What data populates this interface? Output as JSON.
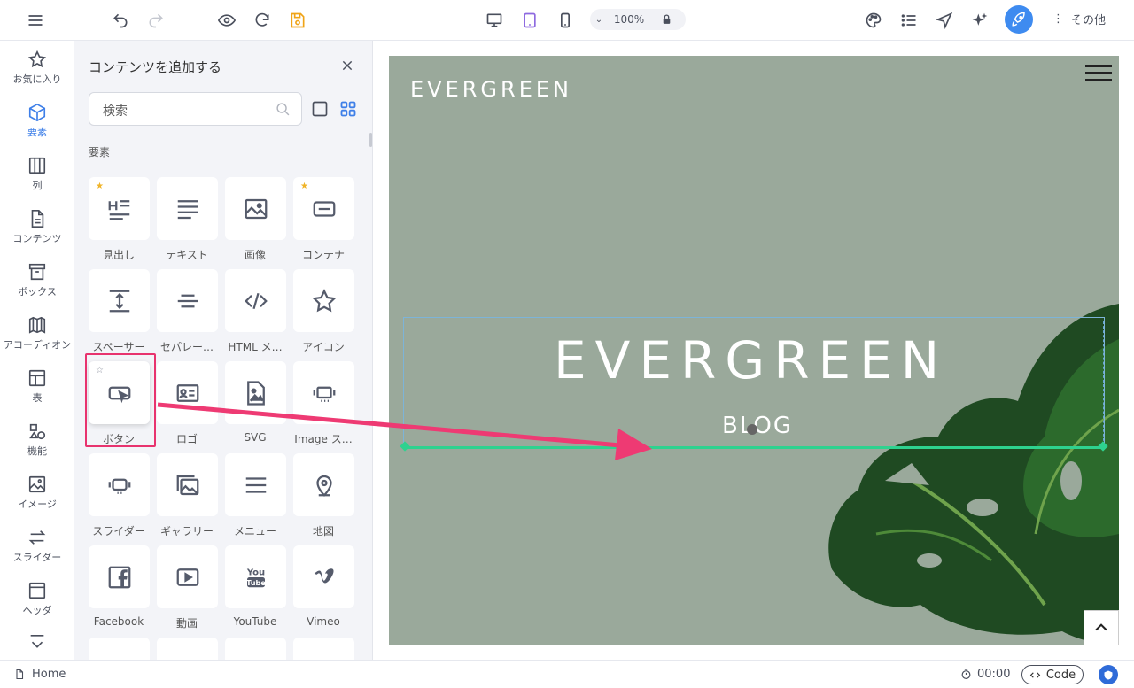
{
  "toolbar": {
    "zoom_value": "100%",
    "more_label": "その他"
  },
  "sidebar": {
    "items": [
      {
        "label": "お気に入り"
      },
      {
        "label": "要素"
      },
      {
        "label": "列"
      },
      {
        "label": "コンテンツ"
      },
      {
        "label": "ボックス"
      },
      {
        "label": "アコーディオン"
      },
      {
        "label": "表"
      },
      {
        "label": "機能"
      },
      {
        "label": "イメージ"
      },
      {
        "label": "スライダー"
      },
      {
        "label": "ヘッダ"
      }
    ]
  },
  "panel": {
    "title": "コンテンツを追加する",
    "search_placeholder": "検索",
    "section_label": "要素",
    "tiles": [
      {
        "label": "見出し",
        "icon": "heading-icon",
        "star": "filled"
      },
      {
        "label": "テキスト",
        "icon": "text-icon",
        "star": ""
      },
      {
        "label": "画像",
        "icon": "image-icon",
        "star": ""
      },
      {
        "label": "コンテナ",
        "icon": "container-icon",
        "star": "filled"
      },
      {
        "label": "スペーサー",
        "icon": "spacer-icon",
        "star": ""
      },
      {
        "label": "セパレー…",
        "icon": "separator-icon",
        "star": ""
      },
      {
        "label": "HTML メ…",
        "icon": "code-icon",
        "star": ""
      },
      {
        "label": "アイコン",
        "icon": "star-icon",
        "star": ""
      },
      {
        "label": "ボタン",
        "icon": "button-icon",
        "star": "empty"
      },
      {
        "label": "ロゴ",
        "icon": "logo-icon",
        "star": ""
      },
      {
        "label": "SVG",
        "icon": "svg-icon",
        "star": ""
      },
      {
        "label": "Image ス…",
        "icon": "image-slider-icon",
        "star": ""
      },
      {
        "label": "スライダー",
        "icon": "slider-icon",
        "star": ""
      },
      {
        "label": "ギャラリー",
        "icon": "gallery-icon",
        "star": ""
      },
      {
        "label": "メニュー",
        "icon": "menu-icon",
        "star": ""
      },
      {
        "label": "地図",
        "icon": "map-pin-icon",
        "star": ""
      },
      {
        "label": "Facebook",
        "icon": "facebook-icon",
        "star": ""
      },
      {
        "label": "動画",
        "icon": "video-icon",
        "star": ""
      },
      {
        "label": "YouTube",
        "icon": "youtube-icon",
        "star": ""
      },
      {
        "label": "Vimeo",
        "icon": "vimeo-icon",
        "star": ""
      }
    ]
  },
  "preview": {
    "logo": "EVERGREEN",
    "hero_title": "EVERGREEN",
    "hero_subtitle": "BLOG"
  },
  "bottombar": {
    "page": "Home",
    "time": "00:00",
    "code_label": "Code"
  },
  "colors": {
    "accent": "#3e8bf0",
    "highlight": "#e8336e",
    "selection": "#2ed28f",
    "preview_bg": "#9aa99b"
  }
}
